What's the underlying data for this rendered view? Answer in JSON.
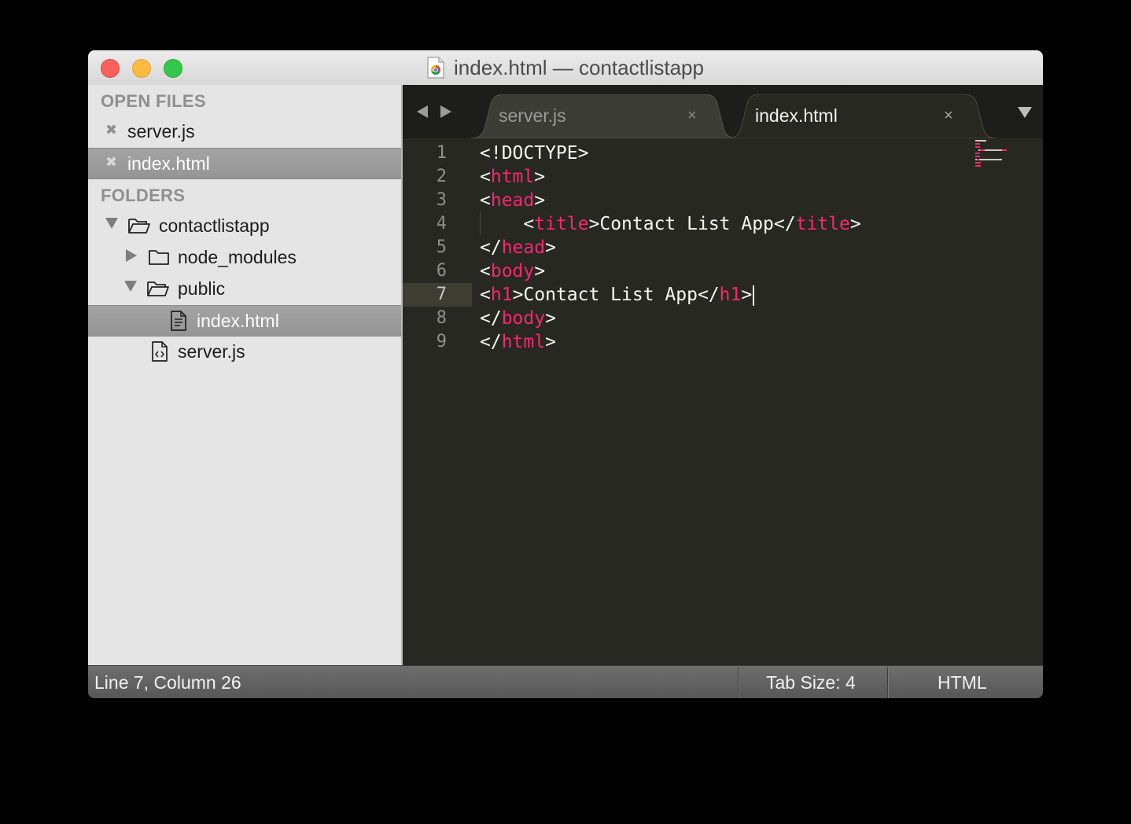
{
  "window": {
    "title": "index.html — contactlistapp",
    "traffic_lights": {
      "close": "#fc605c",
      "minimize": "#fdbc40",
      "zoom": "#34c84a"
    }
  },
  "sidebar": {
    "open_files_header": "OPEN FILES",
    "open_files": [
      {
        "label": "server.js",
        "selected": false
      },
      {
        "label": "index.html",
        "selected": true
      }
    ],
    "folders_header": "FOLDERS",
    "tree": [
      {
        "label": "contactlistapp",
        "type": "folder",
        "expanded": true
      },
      {
        "label": "node_modules",
        "type": "folder",
        "expanded": false
      },
      {
        "label": "public",
        "type": "folder",
        "expanded": true
      },
      {
        "label": "index.html",
        "type": "file",
        "selected": true
      },
      {
        "label": "server.js",
        "type": "file",
        "selected": false
      }
    ]
  },
  "tabs": [
    {
      "label": "server.js",
      "active": false,
      "close": "×"
    },
    {
      "label": "index.html",
      "active": true,
      "close": "×"
    }
  ],
  "editor": {
    "current_line": 7,
    "tag_color": "#f92672",
    "text_color": "#f8f8f2",
    "line_numbers": [
      "1",
      "2",
      "3",
      "4",
      "5",
      "6",
      "7",
      "8",
      "9"
    ],
    "lines": [
      [
        {
          "t": "<!DOCTYPE>",
          "k": "plain"
        }
      ],
      [
        {
          "t": "<",
          "k": "plain"
        },
        {
          "t": "html",
          "k": "tag"
        },
        {
          "t": ">",
          "k": "plain"
        }
      ],
      [
        {
          "t": "<",
          "k": "plain"
        },
        {
          "t": "head",
          "k": "tag"
        },
        {
          "t": ">",
          "k": "plain"
        }
      ],
      [
        {
          "t": "    <",
          "k": "plain"
        },
        {
          "t": "title",
          "k": "tag"
        },
        {
          "t": ">Contact List App</",
          "k": "plain"
        },
        {
          "t": "title",
          "k": "tag"
        },
        {
          "t": ">",
          "k": "plain"
        }
      ],
      [
        {
          "t": "</",
          "k": "plain"
        },
        {
          "t": "head",
          "k": "tag"
        },
        {
          "t": ">",
          "k": "plain"
        }
      ],
      [
        {
          "t": "<",
          "k": "plain"
        },
        {
          "t": "body",
          "k": "tag"
        },
        {
          "t": ">",
          "k": "plain"
        }
      ],
      [
        {
          "t": "<",
          "k": "plain"
        },
        {
          "t": "h1",
          "k": "tag"
        },
        {
          "t": ">Contact List App</",
          "k": "plain"
        },
        {
          "t": "h1",
          "k": "tag"
        },
        {
          "t": ">",
          "k": "plain"
        }
      ],
      [
        {
          "t": "</",
          "k": "plain"
        },
        {
          "t": "body",
          "k": "tag"
        },
        {
          "t": ">",
          "k": "plain"
        }
      ],
      [
        {
          "t": "</",
          "k": "plain"
        },
        {
          "t": "html",
          "k": "tag"
        },
        {
          "t": ">",
          "k": "plain"
        }
      ]
    ]
  },
  "statusbar": {
    "position": "Line 7, Column 26",
    "tab_size": "Tab Size: 4",
    "syntax": "HTML"
  }
}
